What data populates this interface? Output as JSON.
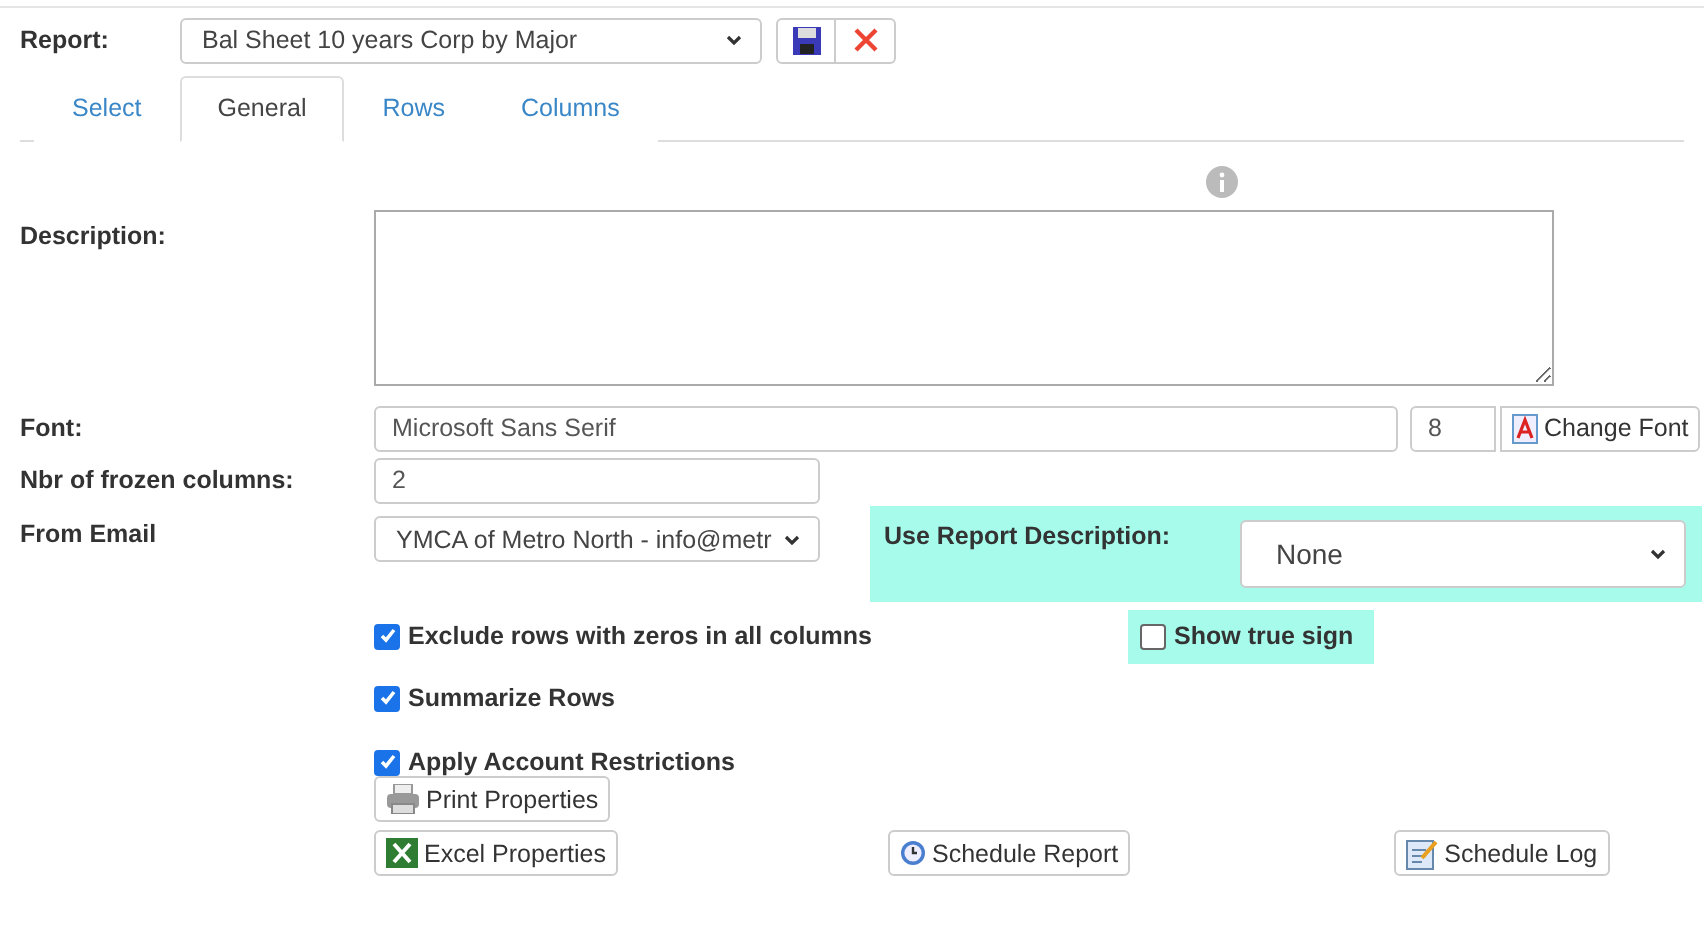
{
  "report": {
    "label": "Report:",
    "value": "Bal Sheet 10 years Corp by Major"
  },
  "tabs": [
    {
      "label": "Select",
      "selected": false
    },
    {
      "label": "General",
      "selected": true
    },
    {
      "label": "Rows",
      "selected": false
    },
    {
      "label": "Columns",
      "selected": false
    }
  ],
  "form": {
    "description_label": "Description:",
    "font_label": "Font:",
    "font_value": "Microsoft Sans Serif",
    "font_size": "8",
    "change_font": "Change Font",
    "frozen_label": "Nbr of frozen columns:",
    "frozen_value": "2",
    "email_label": "From Email",
    "email_value": "YMCA of Metro North - info@metr",
    "use_desc_label": "Use Report Description:",
    "use_desc_value": "None"
  },
  "options": [
    {
      "label": "Exclude rows with zeros in all columns",
      "checked": true
    },
    {
      "label": "Summarize Rows",
      "checked": true
    },
    {
      "label": "Apply Account Restrictions",
      "checked": true
    }
  ],
  "show_true_sign": {
    "label": "Show true sign",
    "checked": false
  },
  "buttons": {
    "print": "Print Properties",
    "excel": "Excel Properties",
    "schedule": "Schedule Report",
    "log": "Schedule Log"
  }
}
